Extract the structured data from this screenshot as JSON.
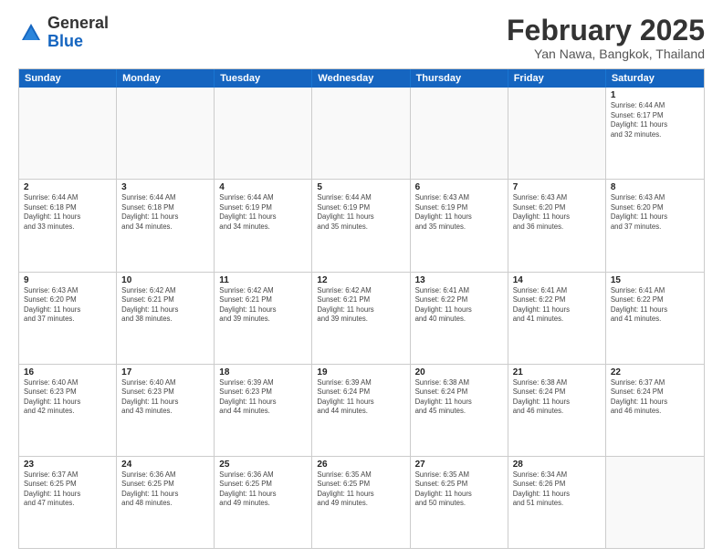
{
  "header": {
    "logo_general": "General",
    "logo_blue": "Blue",
    "title": "February 2025",
    "subtitle": "Yan Nawa, Bangkok, Thailand"
  },
  "weekdays": [
    "Sunday",
    "Monday",
    "Tuesday",
    "Wednesday",
    "Thursday",
    "Friday",
    "Saturday"
  ],
  "rows": [
    [
      {
        "day": "",
        "info": ""
      },
      {
        "day": "",
        "info": ""
      },
      {
        "day": "",
        "info": ""
      },
      {
        "day": "",
        "info": ""
      },
      {
        "day": "",
        "info": ""
      },
      {
        "day": "",
        "info": ""
      },
      {
        "day": "1",
        "info": "Sunrise: 6:44 AM\nSunset: 6:17 PM\nDaylight: 11 hours\nand 32 minutes."
      }
    ],
    [
      {
        "day": "2",
        "info": "Sunrise: 6:44 AM\nSunset: 6:18 PM\nDaylight: 11 hours\nand 33 minutes."
      },
      {
        "day": "3",
        "info": "Sunrise: 6:44 AM\nSunset: 6:18 PM\nDaylight: 11 hours\nand 34 minutes."
      },
      {
        "day": "4",
        "info": "Sunrise: 6:44 AM\nSunset: 6:19 PM\nDaylight: 11 hours\nand 34 minutes."
      },
      {
        "day": "5",
        "info": "Sunrise: 6:44 AM\nSunset: 6:19 PM\nDaylight: 11 hours\nand 35 minutes."
      },
      {
        "day": "6",
        "info": "Sunrise: 6:43 AM\nSunset: 6:19 PM\nDaylight: 11 hours\nand 35 minutes."
      },
      {
        "day": "7",
        "info": "Sunrise: 6:43 AM\nSunset: 6:20 PM\nDaylight: 11 hours\nand 36 minutes."
      },
      {
        "day": "8",
        "info": "Sunrise: 6:43 AM\nSunset: 6:20 PM\nDaylight: 11 hours\nand 37 minutes."
      }
    ],
    [
      {
        "day": "9",
        "info": "Sunrise: 6:43 AM\nSunset: 6:20 PM\nDaylight: 11 hours\nand 37 minutes."
      },
      {
        "day": "10",
        "info": "Sunrise: 6:42 AM\nSunset: 6:21 PM\nDaylight: 11 hours\nand 38 minutes."
      },
      {
        "day": "11",
        "info": "Sunrise: 6:42 AM\nSunset: 6:21 PM\nDaylight: 11 hours\nand 39 minutes."
      },
      {
        "day": "12",
        "info": "Sunrise: 6:42 AM\nSunset: 6:21 PM\nDaylight: 11 hours\nand 39 minutes."
      },
      {
        "day": "13",
        "info": "Sunrise: 6:41 AM\nSunset: 6:22 PM\nDaylight: 11 hours\nand 40 minutes."
      },
      {
        "day": "14",
        "info": "Sunrise: 6:41 AM\nSunset: 6:22 PM\nDaylight: 11 hours\nand 41 minutes."
      },
      {
        "day": "15",
        "info": "Sunrise: 6:41 AM\nSunset: 6:22 PM\nDaylight: 11 hours\nand 41 minutes."
      }
    ],
    [
      {
        "day": "16",
        "info": "Sunrise: 6:40 AM\nSunset: 6:23 PM\nDaylight: 11 hours\nand 42 minutes."
      },
      {
        "day": "17",
        "info": "Sunrise: 6:40 AM\nSunset: 6:23 PM\nDaylight: 11 hours\nand 43 minutes."
      },
      {
        "day": "18",
        "info": "Sunrise: 6:39 AM\nSunset: 6:23 PM\nDaylight: 11 hours\nand 44 minutes."
      },
      {
        "day": "19",
        "info": "Sunrise: 6:39 AM\nSunset: 6:24 PM\nDaylight: 11 hours\nand 44 minutes."
      },
      {
        "day": "20",
        "info": "Sunrise: 6:38 AM\nSunset: 6:24 PM\nDaylight: 11 hours\nand 45 minutes."
      },
      {
        "day": "21",
        "info": "Sunrise: 6:38 AM\nSunset: 6:24 PM\nDaylight: 11 hours\nand 46 minutes."
      },
      {
        "day": "22",
        "info": "Sunrise: 6:37 AM\nSunset: 6:24 PM\nDaylight: 11 hours\nand 46 minutes."
      }
    ],
    [
      {
        "day": "23",
        "info": "Sunrise: 6:37 AM\nSunset: 6:25 PM\nDaylight: 11 hours\nand 47 minutes."
      },
      {
        "day": "24",
        "info": "Sunrise: 6:36 AM\nSunset: 6:25 PM\nDaylight: 11 hours\nand 48 minutes."
      },
      {
        "day": "25",
        "info": "Sunrise: 6:36 AM\nSunset: 6:25 PM\nDaylight: 11 hours\nand 49 minutes."
      },
      {
        "day": "26",
        "info": "Sunrise: 6:35 AM\nSunset: 6:25 PM\nDaylight: 11 hours\nand 49 minutes."
      },
      {
        "day": "27",
        "info": "Sunrise: 6:35 AM\nSunset: 6:25 PM\nDaylight: 11 hours\nand 50 minutes."
      },
      {
        "day": "28",
        "info": "Sunrise: 6:34 AM\nSunset: 6:26 PM\nDaylight: 11 hours\nand 51 minutes."
      },
      {
        "day": "",
        "info": ""
      }
    ]
  ]
}
